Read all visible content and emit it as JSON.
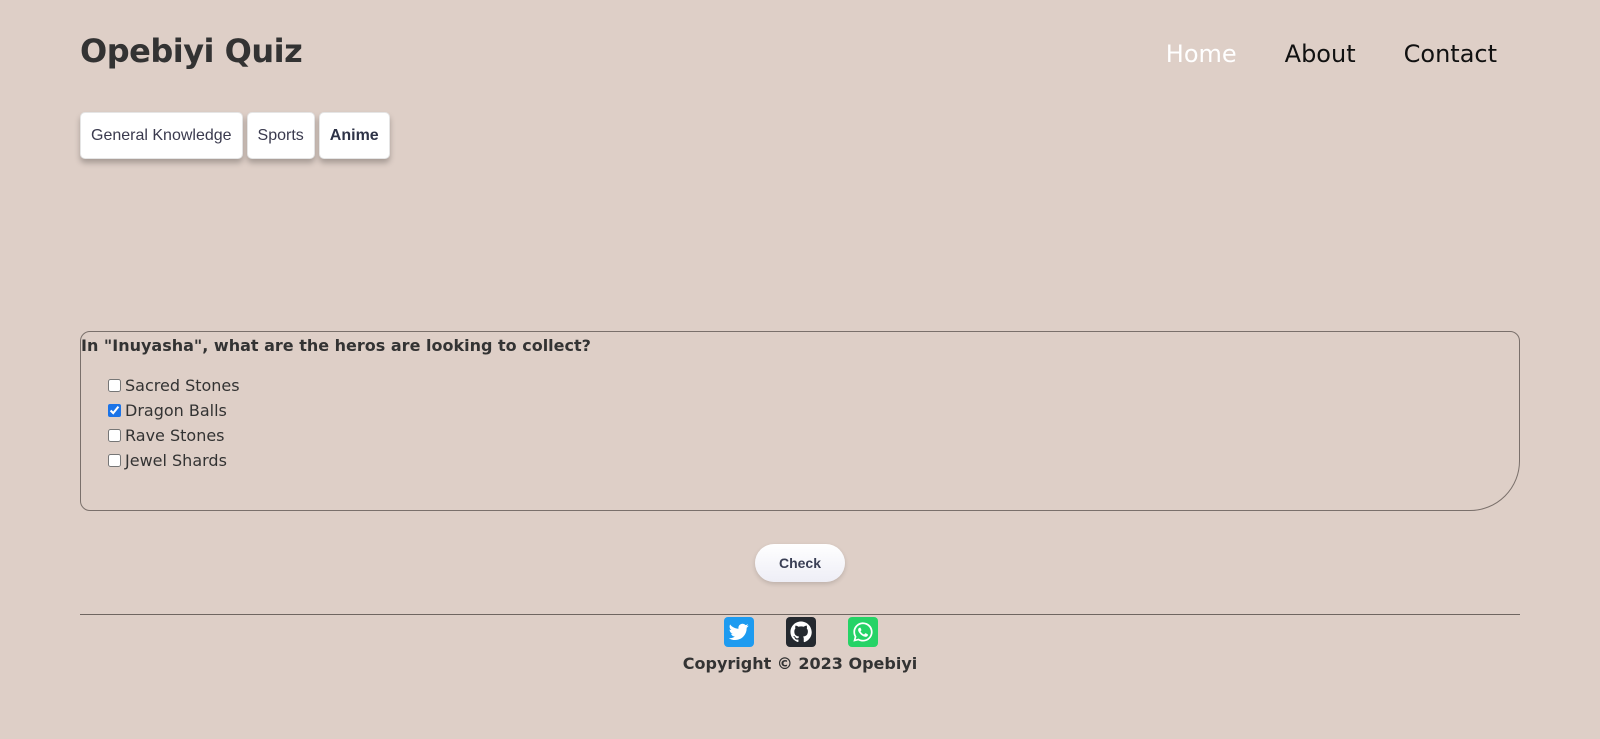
{
  "header": {
    "brand": "Opebiyi Quiz",
    "nav": [
      {
        "label": "Home",
        "active": true
      },
      {
        "label": "About",
        "active": false
      },
      {
        "label": "Contact",
        "active": false
      }
    ]
  },
  "categories": [
    {
      "label": "General Knowledge",
      "selected": false
    },
    {
      "label": "Sports",
      "selected": false
    },
    {
      "label": "Anime",
      "selected": true
    }
  ],
  "question": {
    "text": "In \"Inuyasha\", what are the heros are looking to collect?",
    "options": [
      {
        "label": "Sacred Stones",
        "checked": false
      },
      {
        "label": "Dragon Balls",
        "checked": true
      },
      {
        "label": "Rave Stones",
        "checked": false
      },
      {
        "label": "Jewel Shards",
        "checked": false
      }
    ]
  },
  "actions": {
    "check_label": "Check"
  },
  "footer": {
    "socials": [
      {
        "name": "twitter-icon",
        "color": "#1d9bf0"
      },
      {
        "name": "github-icon",
        "color": "#24292f"
      },
      {
        "name": "whatsapp-icon",
        "color": "#25d366"
      }
    ],
    "copyright": "Copyright © 2023 Opebiyi"
  },
  "colors": {
    "background": "#decfc7",
    "nav_active": "#ffffff",
    "checkbox_accent": "#1a73e8"
  }
}
